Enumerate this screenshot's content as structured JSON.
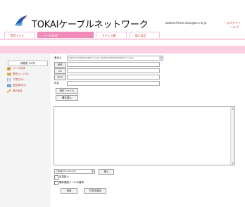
{
  "header": {
    "brand": "TOKAIケーブルネットワーク",
    "account": "webmail-test-alias@tcn.ne.jp",
    "logout_label": "- ログアウト",
    "help_label": "ヘルプ"
  },
  "tabs": [
    {
      "label": "受信トレイ"
    },
    {
      "label": "メール作成"
    },
    {
      "label": "アドレス帳"
    },
    {
      "label": "個人設定"
    }
  ],
  "sidebar": {
    "user_box": "新着数 0/0件",
    "items": [
      {
        "label": "メール作成",
        "icon": "compose-icon"
      },
      {
        "label": "受信トレイ(0)",
        "icon": "inbox-icon"
      },
      {
        "label": "下書き(0)",
        "icon": "drafts-icon"
      },
      {
        "label": "送信済み(0)",
        "icon": "sent-icon"
      },
      {
        "label": "個人設定",
        "icon": "settings-icon"
      }
    ]
  },
  "compose": {
    "from_label": "差出人",
    "from_value": "webmail-test-alias@tcn.ne.jp <webmail-test-alias@tcn.ne.jp>",
    "to_button": "宛先",
    "cc_button": "CC",
    "bcc_button": "BCC",
    "subject_label": "件名",
    "attach_button": "添付ファイル",
    "signature_button": "署名挿入",
    "charset_value": "日本語(ISO-2022-JP)",
    "insert_button": "挿入",
    "option_high_priority": "至急扱い",
    "option_receipt": "開封確認メールの要求",
    "send_button": "送信",
    "draft_button": "下書き保存"
  },
  "colors": {
    "accent": "#f08bb9",
    "accent_light": "#f9cfe1",
    "link": "#c0392b"
  }
}
